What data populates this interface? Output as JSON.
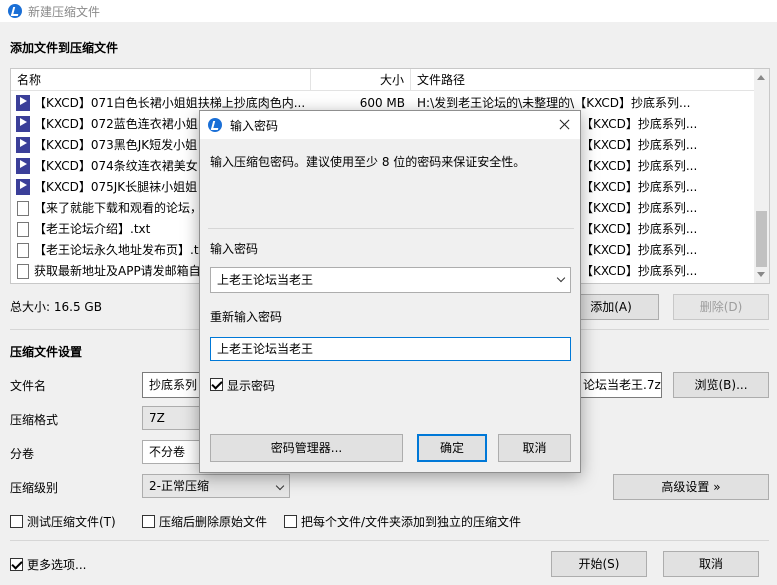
{
  "window": {
    "title": "新建压缩文件"
  },
  "sections": {
    "add_files": "添加文件到压缩文件",
    "settings": "压缩文件设置"
  },
  "filelist": {
    "headers": [
      "名称",
      "大小",
      "文件路径"
    ],
    "rows": [
      {
        "type": "video",
        "name": "【KXCD】071白色长裙小姐姐扶梯上抄底肉色内...",
        "size": "600 MB",
        "path": "H:\\发到老王论坛的\\未整理的\\【KXCD】抄底系列..."
      },
      {
        "type": "video",
        "name": "【KXCD】072蓝色连衣裙小姐",
        "size": "",
        "path": "【KXCD】抄底系列..."
      },
      {
        "type": "video",
        "name": "【KXCD】073黑色JK短发小姐",
        "size": "",
        "path": "【KXCD】抄底系列..."
      },
      {
        "type": "video",
        "name": "【KXCD】074条纹连衣裙美女",
        "size": "",
        "path": "【KXCD】抄底系列..."
      },
      {
        "type": "video",
        "name": "【KXCD】075JK长腿袜小姐姐",
        "size": "",
        "path": "【KXCD】抄底系列..."
      },
      {
        "type": "text",
        "name": "【来了就能下载和观看的论坛，",
        "size": "",
        "path": "【KXCD】抄底系列..."
      },
      {
        "type": "text",
        "name": "【老王论坛介绍】.txt",
        "size": "",
        "path": "【KXCD】抄底系列..."
      },
      {
        "type": "text",
        "name": "【老王论坛永久地址发布页】.tx",
        "size": "",
        "path": "【KXCD】抄底系列..."
      },
      {
        "type": "text",
        "name": "获取最新地址及APP请发邮箱自",
        "size": "",
        "path": "【KXCD】抄底系列..."
      }
    ]
  },
  "total_size": "总大小: 16.5 GB",
  "buttons": {
    "add": "添加(A)",
    "delete": "删除(D)",
    "browse": "浏览(B)...",
    "advanced": "高级设置 »",
    "start": "开始(S)",
    "cancel": "取消"
  },
  "settings": {
    "filename_label": "文件名",
    "filename_value_left": "抄底系列",
    "filename_value_right": "论坛当老王.7z",
    "format_label": "压缩格式",
    "format_value": "7Z",
    "split_label": "分卷",
    "split_value": "不分卷",
    "level_label": "压缩级别",
    "level_value": "2-正常压缩"
  },
  "options": {
    "test": "测试压缩文件(T)",
    "delete_after": "压缩后删除原始文件",
    "each_separate": "把每个文件/文件夹添加到独立的压缩文件",
    "more": "更多选项..."
  },
  "dialog": {
    "title": "输入密码",
    "description": "输入压缩包密码。建议使用至少 8 位的密码来保证安全性。",
    "password_label": "输入密码",
    "password_value": "上老王论坛当老王",
    "confirm_label": "重新输入密码",
    "confirm_value": "上老王论坛当老王",
    "show_password": "显示密码",
    "manager": "密码管理器...",
    "ok": "确定",
    "cancel": "取消"
  },
  "colors": {
    "accent": "#1a6fd6",
    "focus_border": "#0078d7",
    "video_icon": "#3b3f99"
  }
}
